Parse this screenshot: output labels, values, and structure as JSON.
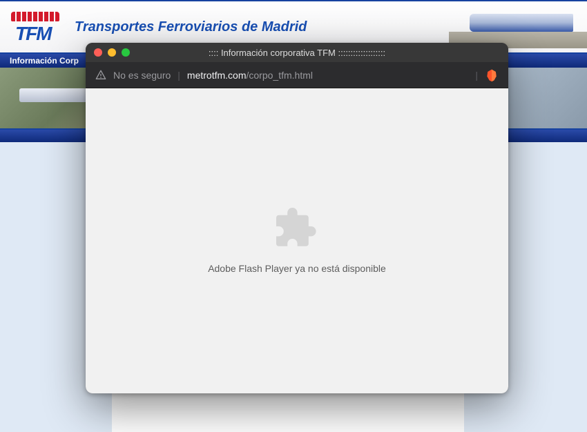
{
  "background": {
    "logo_acronym": "TFM",
    "site_title": "Transportes Ferroviarios de Madrid",
    "nav_item": "Información Corp"
  },
  "popup": {
    "window_title": ":::: Información corporativa TFM :::::::::::::::::::",
    "security_label": "No es seguro",
    "url_host": "metrotfm.com",
    "url_path": "/corpo_tfm.html",
    "flash_message": "Adobe Flash Player ya no está disponible"
  }
}
